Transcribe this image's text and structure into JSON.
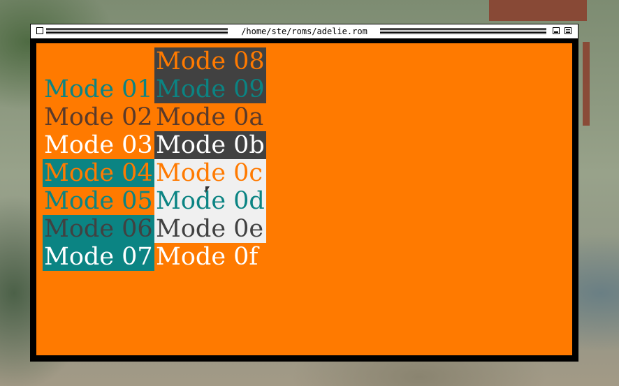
{
  "window": {
    "title": "/home/ste/roms/adelie.rom"
  },
  "colors": {
    "orange": "#ff7a00",
    "teal": "#0b8483",
    "dark": "#414141",
    "light": "#f0f0f0",
    "brown": "#5a3a2a",
    "white": "#ffffff"
  },
  "modes": [
    {
      "label": "Mode 01",
      "fg": "#0b8483",
      "bg": "transparent"
    },
    {
      "label": "Mode 02",
      "fg": "#5a3a2a",
      "bg": "transparent"
    },
    {
      "label": "Mode 03",
      "fg": "#ffffff",
      "bg": "transparent"
    },
    {
      "label": "Mode 04",
      "fg": "#ff7a00",
      "bg": "#0b8483"
    },
    {
      "label": "Mode 05",
      "fg": "#0b8483",
      "bg": "transparent"
    },
    {
      "label": "Mode 06",
      "fg": "#414141",
      "bg": "#0b8483"
    },
    {
      "label": "Mode 07",
      "fg": "#ffffff",
      "bg": "#0b8483"
    },
    {
      "label": "Mode 08",
      "fg": "#ff7a00",
      "bg": "#414141"
    },
    {
      "label": "Mode 09",
      "fg": "#0b8483",
      "bg": "#414141"
    },
    {
      "label": "Mode 0a",
      "fg": "#5a3a2a",
      "bg": "transparent"
    },
    {
      "label": "Mode 0b",
      "fg": "#ffffff",
      "bg": "#414141"
    },
    {
      "label": "Mode 0c",
      "fg": "#ff7a00",
      "bg": "#f0f0f0"
    },
    {
      "label": "Mode 0d",
      "fg": "#0b8483",
      "bg": "#f0f0f0"
    },
    {
      "label": "Mode 0e",
      "fg": "#414141",
      "bg": "#f0f0f0"
    },
    {
      "label": "Mode 0f",
      "fg": "#ffffff",
      "bg": "transparent"
    }
  ]
}
